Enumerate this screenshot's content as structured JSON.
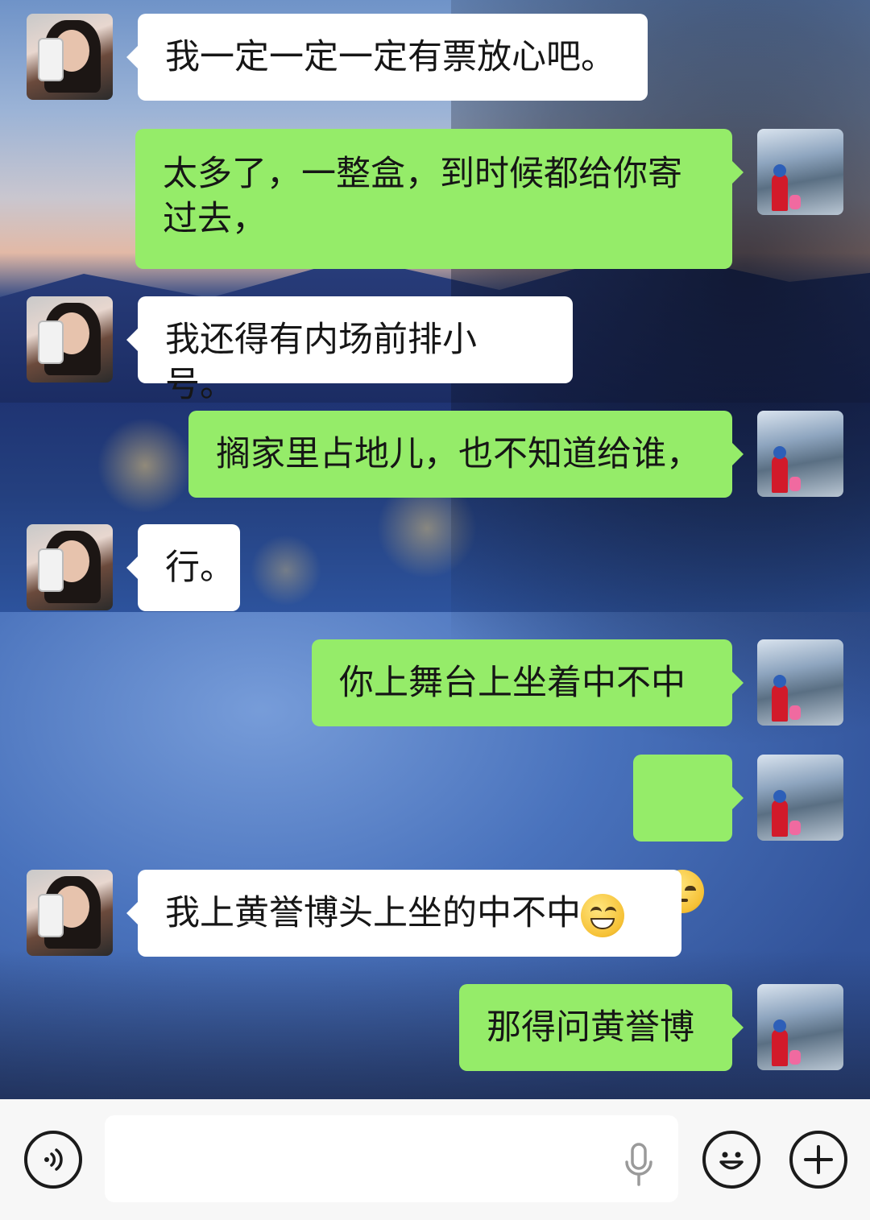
{
  "chat": {
    "messages": [
      {
        "side": "left",
        "text": "我一定一定一定有票放心吧。"
      },
      {
        "side": "right",
        "text": "太多了，一整盒，到时候都给你寄过去，"
      },
      {
        "side": "left",
        "text": "我还得有内场前排小号。"
      },
      {
        "side": "right",
        "text": "搁家里占地儿，也不知道给谁，"
      },
      {
        "side": "left",
        "text": "行。"
      },
      {
        "side": "right",
        "text": "你上舞台上坐着中不中"
      },
      {
        "side": "right",
        "emoji": "unamused-face-emoji"
      },
      {
        "side": "left",
        "text": "我上黄誉博头上坐的中不中",
        "trailing_emoji": "grinning-face-emoji"
      },
      {
        "side": "right",
        "text": "那得问黄誉博"
      }
    ]
  },
  "input_bar": {
    "voice_icon": "voice-wave-icon",
    "text_value": "",
    "mic_icon": "microphone-icon",
    "emoji_icon": "smiley-icon",
    "more_icon": "plus-icon"
  },
  "colors": {
    "my_bubble": "#95ec69",
    "their_bubble": "#ffffff",
    "input_bar_bg": "#f7f7f7"
  }
}
